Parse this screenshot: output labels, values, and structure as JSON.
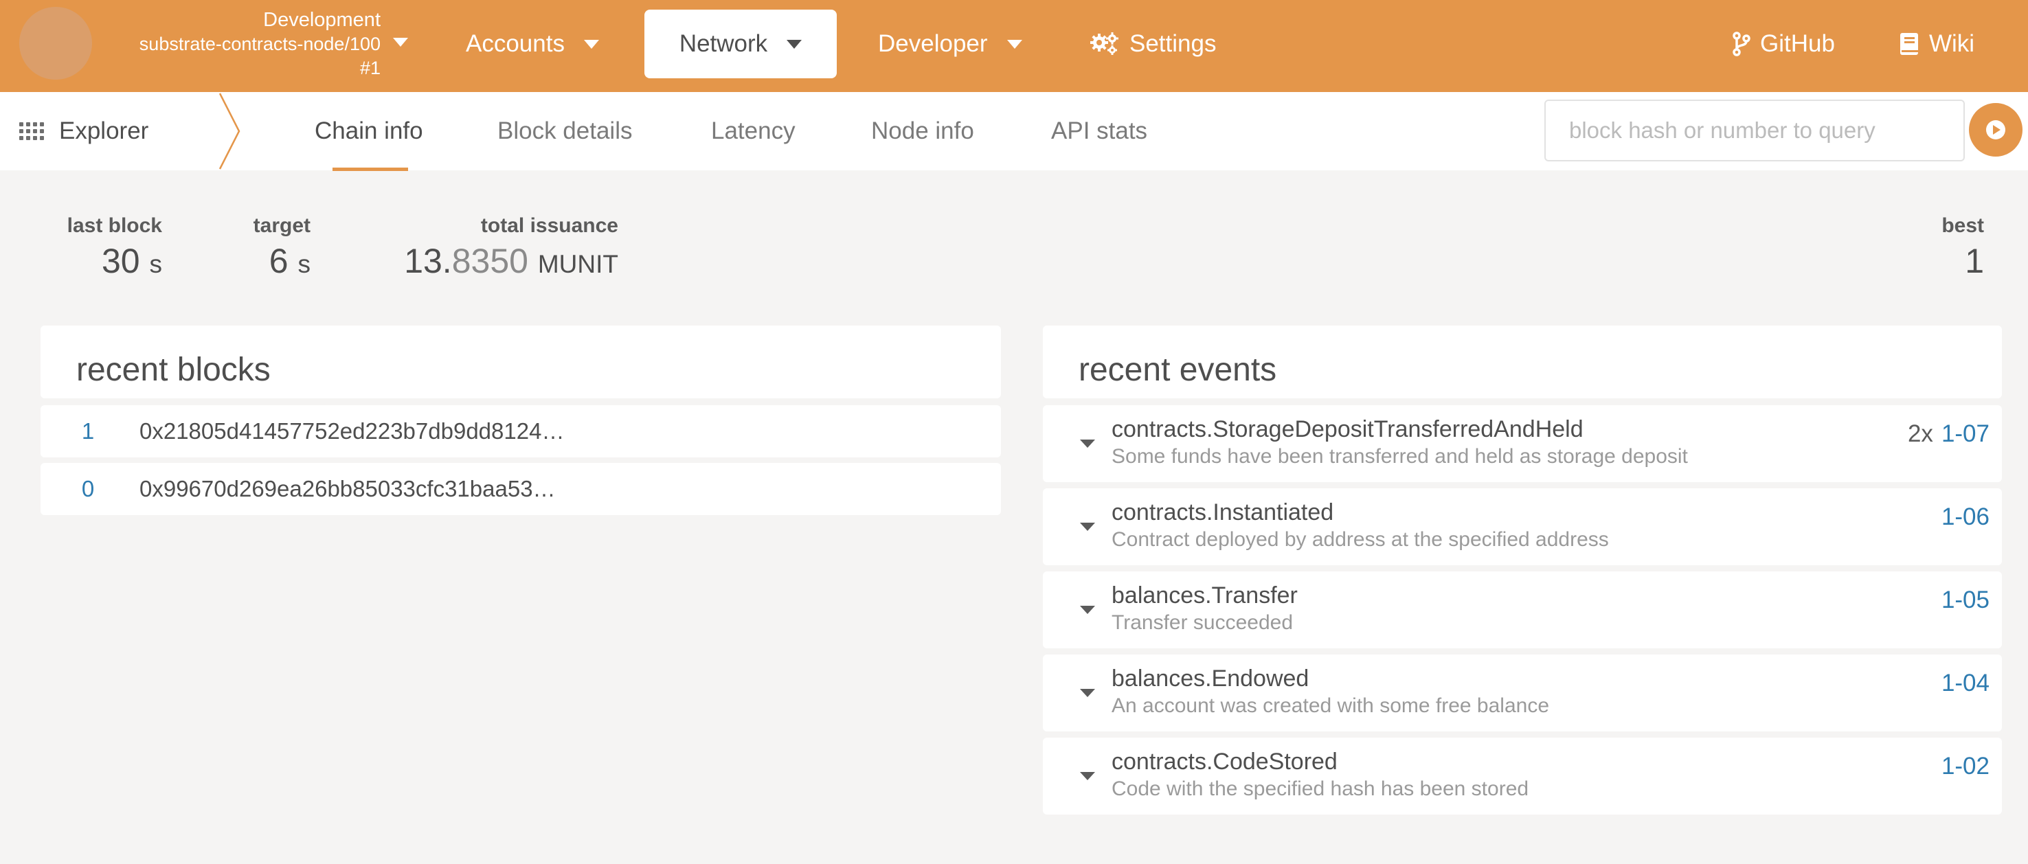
{
  "header": {
    "chain_name": "Development",
    "node": "substrate-contracts-node/100",
    "node_version": "#1",
    "menu": {
      "accounts": "Accounts",
      "network": "Network",
      "developer": "Developer",
      "settings": "Settings",
      "github": "GitHub",
      "wiki": "Wiki"
    },
    "colors": {
      "accent": "#e4964a",
      "link": "#2d7bb0"
    }
  },
  "subnav": {
    "section": "Explorer",
    "tabs": [
      "Chain info",
      "Block details",
      "Latency",
      "Node info",
      "API stats"
    ],
    "active_tab": "Chain info",
    "search_placeholder": "block hash or number to query"
  },
  "stats": {
    "last_block": {
      "label": "last block",
      "value": "30",
      "unit": "s"
    },
    "target": {
      "label": "target",
      "value": "6",
      "unit": "s"
    },
    "total_issuance": {
      "label": "total issuance",
      "int": "13.",
      "frac": "8350",
      "unit": "MUNIT"
    },
    "best": {
      "label": "best",
      "value": "1"
    }
  },
  "recent_blocks": {
    "title": "recent blocks",
    "rows": [
      {
        "number": "1",
        "hash": "0x21805d41457752ed223b7db9dd8124…"
      },
      {
        "number": "0",
        "hash": "0x99670d269ea26bb85033cfc31baa53…"
      }
    ]
  },
  "recent_events": {
    "title": "recent events",
    "rows": [
      {
        "name": "contracts.StorageDepositTransferredAndHeld",
        "desc": "Some funds have been transferred and held as storage deposit",
        "count": "2x",
        "link": "1-07"
      },
      {
        "name": "contracts.Instantiated",
        "desc": "Contract deployed by address at the specified address",
        "count": "",
        "link": "1-06"
      },
      {
        "name": "balances.Transfer",
        "desc": "Transfer succeeded",
        "count": "",
        "link": "1-05"
      },
      {
        "name": "balances.Endowed",
        "desc": "An account was created with some free balance",
        "count": "",
        "link": "1-04"
      },
      {
        "name": "contracts.CodeStored",
        "desc": "Code with the specified hash has been stored",
        "count": "",
        "link": "1-02"
      }
    ]
  }
}
